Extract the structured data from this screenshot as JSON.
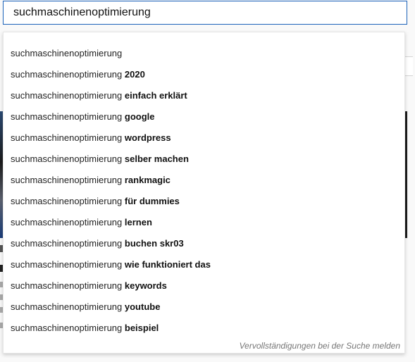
{
  "search": {
    "value": "suchmaschinenoptimierung"
  },
  "suggestions": [
    {
      "typed": "suchmaschinenoptimierung",
      "completion": ""
    },
    {
      "typed": "suchmaschinenoptimierung ",
      "completion": "2020"
    },
    {
      "typed": "suchmaschinenoptimierung ",
      "completion": "einfach erklärt"
    },
    {
      "typed": "suchmaschinenoptimierung ",
      "completion": "google"
    },
    {
      "typed": "suchmaschinenoptimierung ",
      "completion": "wordpress"
    },
    {
      "typed": "suchmaschinenoptimierung ",
      "completion": "selber machen"
    },
    {
      "typed": "suchmaschinenoptimierung ",
      "completion": "rankmagic"
    },
    {
      "typed": "suchmaschinenoptimierung ",
      "completion": "für dummies"
    },
    {
      "typed": "suchmaschinenoptimierung ",
      "completion": "lernen"
    },
    {
      "typed": "suchmaschinenoptimierung ",
      "completion": "buchen skr03"
    },
    {
      "typed": "suchmaschinenoptimierung ",
      "completion": "wie funktioniert das"
    },
    {
      "typed": "suchmaschinenoptimierung ",
      "completion": "keywords"
    },
    {
      "typed": "suchmaschinenoptimierung ",
      "completion": "youtube"
    },
    {
      "typed": "suchmaschinenoptimierung ",
      "completion": "beispiel"
    }
  ],
  "report_label": "Vervollständigungen bei der Suche melden",
  "colors": {
    "focus_border": "#1c62b9",
    "text": "#222222",
    "muted": "#767676"
  }
}
